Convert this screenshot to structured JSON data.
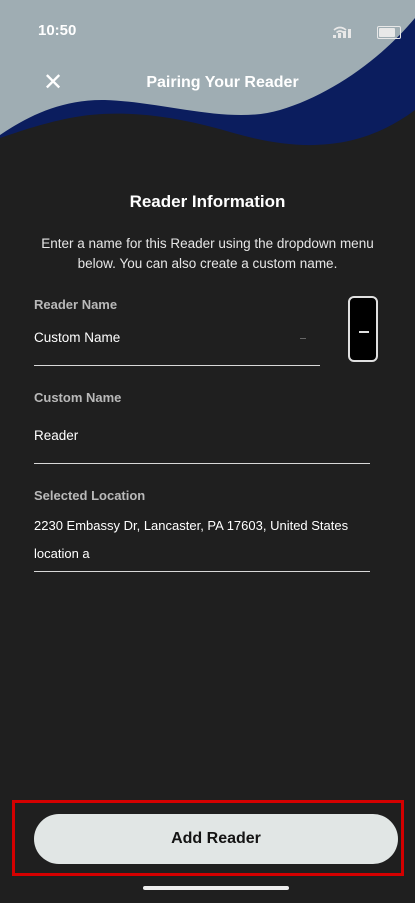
{
  "status_bar": {
    "time": "10:50"
  },
  "header": {
    "title": "Pairing Your Reader",
    "close_symbol": "✕"
  },
  "reader_information": {
    "title": "Reader Information",
    "description": "Enter a name for this Reader using the dropdown menu below. You can also create a custom name."
  },
  "reader_name": {
    "label": "Reader Name",
    "value": "Custom Name"
  },
  "custom_name": {
    "label": "Custom Name",
    "value": "Reader"
  },
  "selected_location": {
    "label": "Selected Location",
    "address": "2230 Embassy Dr, Lancaster, PA 17603, United States",
    "name": "location a"
  },
  "footer": {
    "add_button_label": "Add Reader"
  },
  "colors": {
    "background": "#1f1f1f",
    "header_gray": "#9fadb3",
    "header_navy": "#0b1d5e",
    "button": "#e1e6e5",
    "highlight": "#d40000"
  }
}
